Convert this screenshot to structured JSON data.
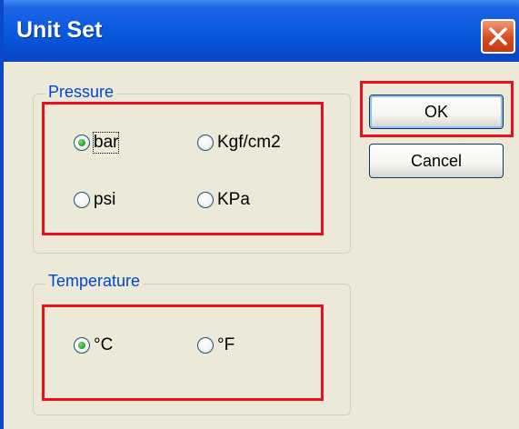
{
  "dialog": {
    "title": "Unit Set",
    "close_icon": "close-x-icon"
  },
  "pressure": {
    "label": "Pressure",
    "options": [
      {
        "label": "bar",
        "selected": true
      },
      {
        "label": "Kgf/cm2",
        "selected": false
      },
      {
        "label": "psi",
        "selected": false
      },
      {
        "label": "KPa",
        "selected": false
      }
    ]
  },
  "temperature": {
    "label": "Temperature",
    "options": [
      {
        "label": "°C",
        "selected": true
      },
      {
        "label": "°F",
        "selected": false
      }
    ]
  },
  "buttons": {
    "ok": "OK",
    "cancel": "Cancel"
  },
  "colors": {
    "highlight_box": "#e8101a",
    "title_bar": "#0a5ce0",
    "group_label": "#0046d5",
    "selected_radio": "#21a121"
  }
}
